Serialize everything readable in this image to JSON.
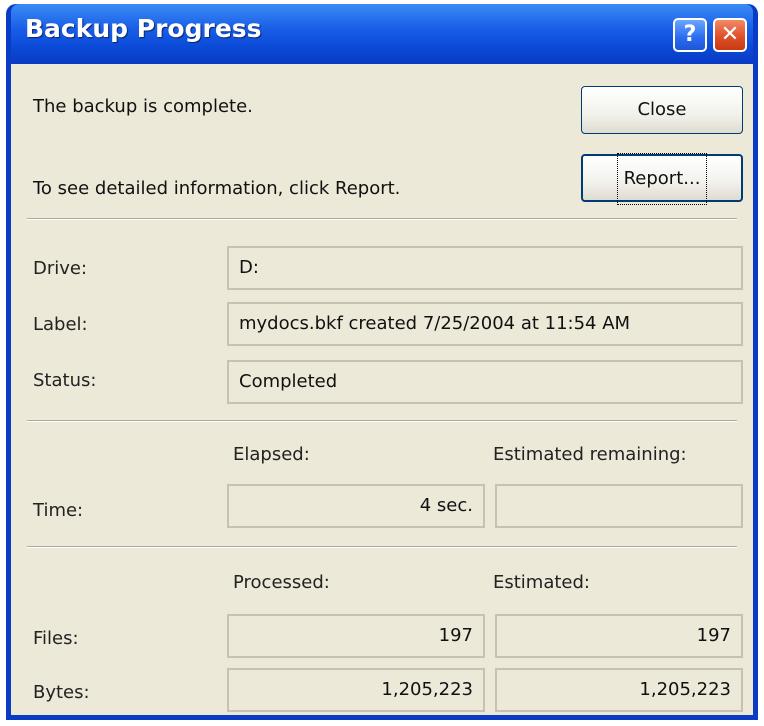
{
  "window": {
    "title": "Backup Progress",
    "help_glyph": "?",
    "close_glyph": "✕"
  },
  "messages": {
    "complete": "The backup is complete.",
    "report_hint": "To see detailed information, click Report."
  },
  "buttons": {
    "close": "Close",
    "report": "Report..."
  },
  "fields": {
    "drive_label": "Drive:",
    "drive_value": "D:",
    "label_label": "Label:",
    "label_value": "mydocs.bkf created 7/25/2004 at 11:54 AM",
    "status_label": "Status:",
    "status_value": "Completed"
  },
  "time": {
    "row_label": "Time:",
    "elapsed_header": "Elapsed:",
    "remaining_header": "Estimated remaining:",
    "elapsed_value": "4 sec.",
    "remaining_value": ""
  },
  "counts": {
    "processed_header": "Processed:",
    "estimated_header": "Estimated:",
    "files_label": "Files:",
    "files_processed": "197",
    "files_estimated": "197",
    "bytes_label": "Bytes:",
    "bytes_processed": "1,205,223",
    "bytes_estimated": "1,205,223"
  },
  "colors": {
    "title_bar": "#0a48d6",
    "dialog_face": "#ece9d8",
    "close_button": "#e0502a",
    "help_button": "#2a6bf0"
  }
}
